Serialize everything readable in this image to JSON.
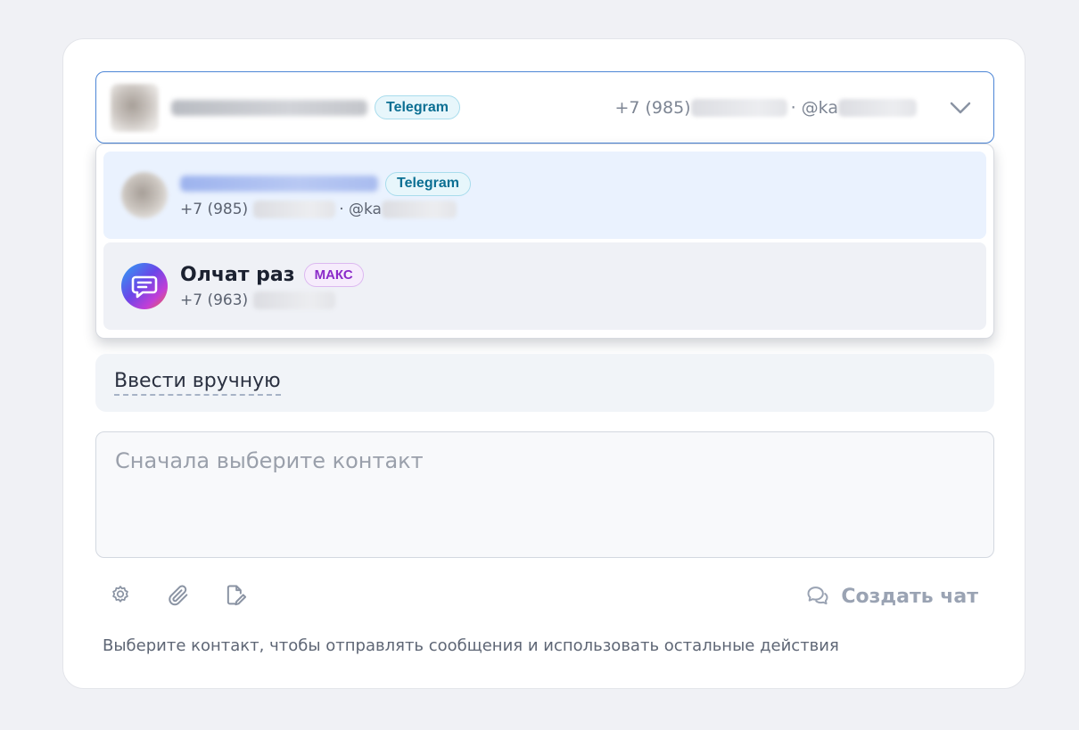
{
  "selected_contact": {
    "messenger_badge": "Telegram",
    "phone_prefix": "+7 (985)",
    "username_prefix": "· @ka"
  },
  "options": [
    {
      "messenger_badge": "Telegram",
      "phone_prefix": "+7 (985)",
      "username_prefix": "· @ka",
      "active": true
    },
    {
      "name": "Олчат раз",
      "messenger_badge": "МАКС",
      "phone_prefix": "+7 (963)",
      "active": false
    }
  ],
  "manual_entry_label": "Ввести вручную",
  "message": {
    "placeholder": "Сначала выберите контакт",
    "value": ""
  },
  "toolbar": {
    "settings_icon": "gear-icon",
    "attach_icon": "paperclip-icon",
    "template_icon": "edit-document-icon",
    "create_chat_label": "Создать чат"
  },
  "hint": "Выберите контакт, чтобы отправлять сообщения и использовать остальные действия",
  "colors": {
    "accent_border": "#4d86d6",
    "telegram_badge": "#0b6f93",
    "max_badge": "#8b2bc9",
    "active_option_bg": "#eaf2fe"
  }
}
